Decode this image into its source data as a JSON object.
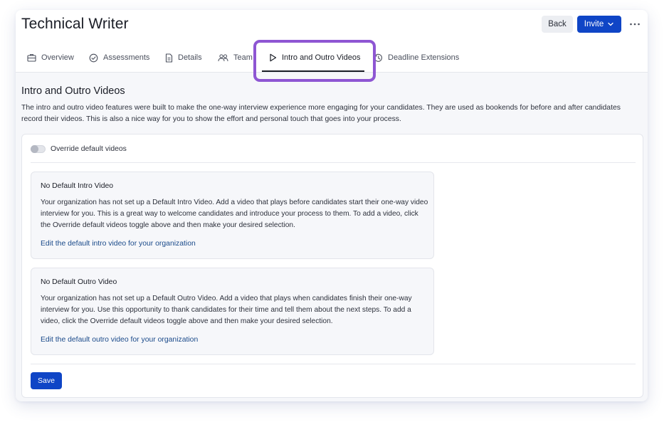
{
  "header": {
    "title": "Technical Writer",
    "back_label": "Back",
    "invite_label": "Invite"
  },
  "tabs": [
    {
      "label": "Overview",
      "icon": "briefcase-icon"
    },
    {
      "label": "Assessments",
      "icon": "check-circle-icon"
    },
    {
      "label": "Details",
      "icon": "document-icon"
    },
    {
      "label": "Team",
      "icon": "people-icon"
    },
    {
      "label": "Intro and Outro Videos",
      "icon": "play-icon",
      "active": true
    },
    {
      "label": "Deadline Extensions",
      "icon": "clock-history-icon"
    }
  ],
  "section": {
    "title": "Intro and Outro Videos",
    "description": "The intro and outro video features were built to make the one-way interview experience more engaging for your candidates. They are used as bookends for before and after candidates record their videos. This is also a nice way for you to show the effort and personal touch that goes into your process."
  },
  "override_toggle": {
    "label": "Override default videos",
    "enabled": false
  },
  "intro_card": {
    "title": "No Default Intro Video",
    "body": "Your organization has not set up a Default Intro Video. Add a video that plays before candidates start their one-way video interview for you. This is a great way to welcome candidates and introduce your process to them. To add a video, click the Override default videos toggle above and then make your desired selection.",
    "link": "Edit the default intro video for your organization"
  },
  "outro_card": {
    "title": "No Default Outro Video",
    "body": "Your organization has not set up a Default Outro Video. Add a video that plays when candidates finish their one-way interview for you. Use this opportunity to thank candidates for their time and tell them about the next steps. To add a video, click the Override default videos toggle above and then make your desired selection.",
    "link": "Edit the default outro video for your organization"
  },
  "save_label": "Save",
  "colors": {
    "primary_button": "#0f45c6",
    "highlight_outline": "#8e56d3",
    "link": "#1a4a8a"
  }
}
